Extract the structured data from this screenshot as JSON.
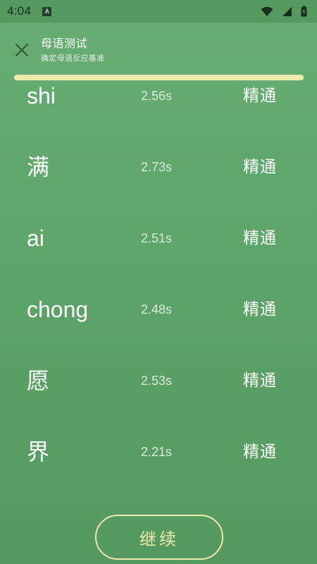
{
  "status_bar": {
    "time": "4:04",
    "notification_badge": "A",
    "icons": [
      "wifi-icon",
      "signal-icon",
      "battery-icon"
    ]
  },
  "header": {
    "close_icon": "close-icon",
    "title": "母语测试",
    "subtitle": "确定母语反应基准"
  },
  "progress": {
    "fraction": 1.0
  },
  "results": [
    {
      "word": "shi",
      "time": "2.56s",
      "level": "精通"
    },
    {
      "word": "满",
      "time": "2.73s",
      "level": "精通"
    },
    {
      "word": "ai",
      "time": "2.51s",
      "level": "精通"
    },
    {
      "word": "chong",
      "time": "2.48s",
      "level": "精通"
    },
    {
      "word": "愿",
      "time": "2.53s",
      "level": "精通"
    },
    {
      "word": "界",
      "time": "2.21s",
      "level": "精通"
    }
  ],
  "footer": {
    "continue_label": "继续"
  },
  "colors": {
    "background": "#5ea56a",
    "status_bar": "#55995f",
    "accent": "#f0ebad",
    "text": "#ffffff"
  }
}
